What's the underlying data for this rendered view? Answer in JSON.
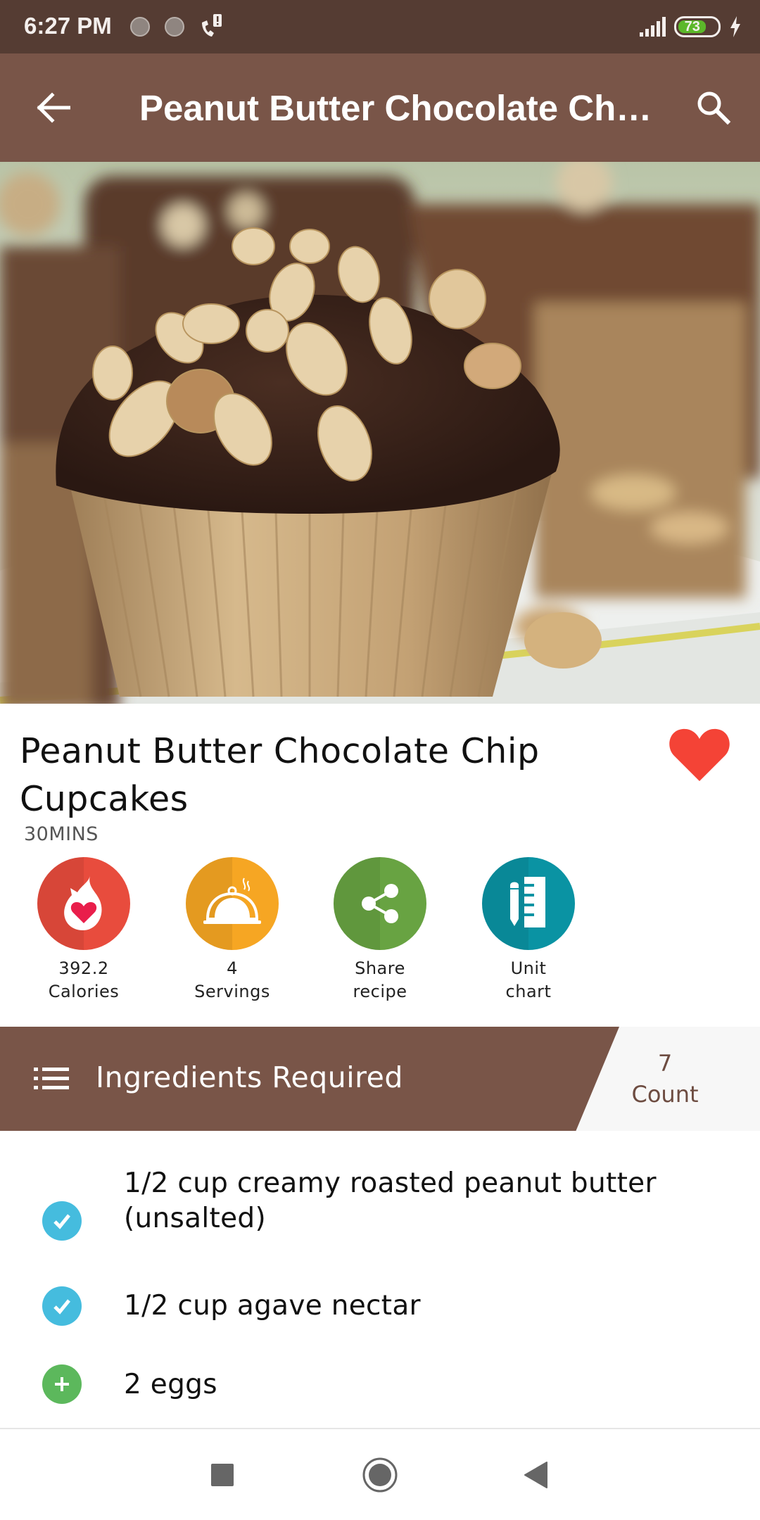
{
  "status_bar": {
    "time": "6:27 PM",
    "notification_icons": [
      "sync-icon",
      "sync-icon",
      "missed-call-icon"
    ],
    "battery_percent": "73",
    "charging": true,
    "signal_bars": 5
  },
  "app_bar": {
    "title": "Peanut Butter Chocolate Chip Cupcakes",
    "back_icon": "arrow-left-icon",
    "search_icon": "search-icon"
  },
  "hero": {
    "alt": "Peanut butter chocolate chip cupcakes topped with chopped peanuts"
  },
  "recipe": {
    "title": "Peanut Butter Chocolate Chip Cupcakes",
    "duration": "30MINS",
    "favorited": true
  },
  "stats": [
    {
      "icon": "calories-flame-heart-icon",
      "value": "392.2",
      "label": "Calories",
      "color": "#e74c3c"
    },
    {
      "icon": "serving-cloche-icon",
      "value": "4",
      "label": "Servings",
      "color": "#f5a623"
    },
    {
      "icon": "share-icon",
      "value": "Share",
      "label": "recipe",
      "color": "#629b3f"
    },
    {
      "icon": "pencil-ruler-icon",
      "value": "Unit",
      "label": "chart",
      "color": "#0a8f9e"
    }
  ],
  "ingredients_header": {
    "title": "Ingredients Required",
    "count": "7",
    "count_label": "Count"
  },
  "ingredients": [
    {
      "text": "1/2 cup creamy roasted peanut butter (unsalted)",
      "status": "checked"
    },
    {
      "text": "1/2 cup agave nectar",
      "status": "checked"
    },
    {
      "text": "2 eggs",
      "status": "add"
    }
  ],
  "nav_bar": {
    "buttons": [
      "recents-button",
      "home-button",
      "back-button"
    ]
  },
  "colors": {
    "primary": "#795548",
    "primary_dark": "#553c33",
    "heart": "#f44336",
    "checked": "#45bcde",
    "add": "#5cb85c"
  }
}
